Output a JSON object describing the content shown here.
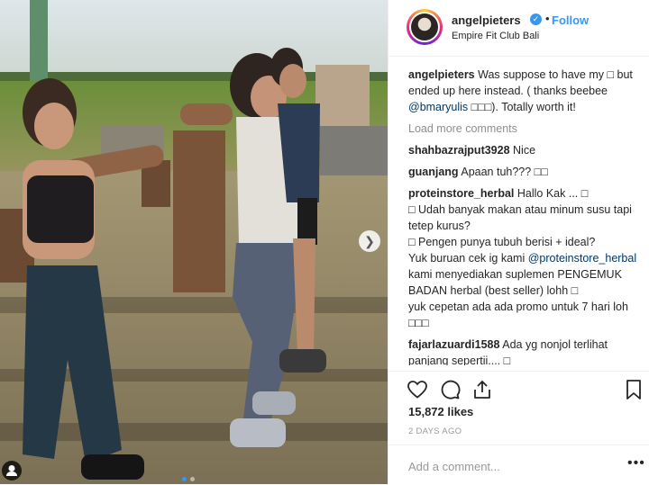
{
  "header": {
    "username": "angelpieters",
    "follow_label": "Follow",
    "separator": "•",
    "location": "Empire Fit Club Bali"
  },
  "caption": {
    "username": "angelpieters",
    "text_before": "Was suppose to have my □ but ended up here instead. ( thanks beebee ",
    "mention": "@bmaryulis",
    "text_after": " □□□). Totally worth it!"
  },
  "load_more": "Load more comments",
  "comments": [
    {
      "username": "shahbazrajput3928",
      "text": "Nice"
    },
    {
      "username": "guanjang",
      "text": "Apaan tuh??? □□"
    },
    {
      "username": "proteinstore_herbal",
      "text": "Hallo Kak ... □\n□ Udah banyak makan atau minum susu tapi tetep kurus?\n□ Pengen punya tubuh berisi + ideal?\nYuk buruan cek ig kami ",
      "mention": "@proteinstore_herbal",
      "text_after": " kami menyediakan suplemen PENGEMUK BADAN herbal (best seller) lohh □\nyuk cepetan ada ada promo untuk 7 hari loh □□□"
    },
    {
      "username": "fajarlazuardi1588",
      "text": "Ada yg nonjol terlihat panjang sepertii.... □"
    }
  ],
  "likes": "15,872 likes",
  "date": "2 DAYS AGO",
  "add_comment_placeholder": "Add a comment...",
  "more_label": "•••",
  "icons": [
    "heart-icon",
    "comment-icon",
    "share-icon",
    "bookmark-icon",
    "verified-badge-icon",
    "chevron-right-icon",
    "user-tag-icon"
  ],
  "colors": {
    "accent": "#3897f0",
    "muted": "#8e8e8e",
    "text": "#262626",
    "mention": "#00376b"
  }
}
